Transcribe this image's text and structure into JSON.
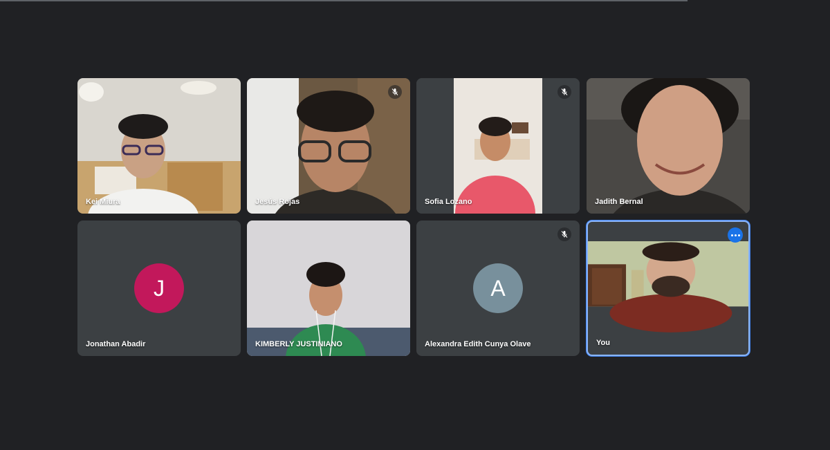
{
  "participants": [
    {
      "name": "Kei Miura",
      "muted": false
    },
    {
      "name": "Jesús Rojas",
      "muted": true
    },
    {
      "name": "Sofia Lozano",
      "muted": true
    },
    {
      "name": "Jadith Bernal",
      "muted": false
    },
    {
      "name": "Jonathan Abadir",
      "muted": false,
      "initial": "J",
      "avatar_color": "#c2185b"
    },
    {
      "name": "KIMBERLY JUSTINIANO",
      "muted": false
    },
    {
      "name": "Alexandra Edith Cunya Olave",
      "muted": true,
      "initial": "A",
      "avatar_color": "#78909c"
    },
    {
      "name": "You",
      "muted": false,
      "self": true
    }
  ],
  "icons": {
    "mic_off": "mic-off-icon",
    "more": "more-options-icon"
  },
  "colors": {
    "background": "#202124",
    "tile": "#3c4043",
    "self_border": "#8ab4f8",
    "more_button": "#1a73e8"
  }
}
